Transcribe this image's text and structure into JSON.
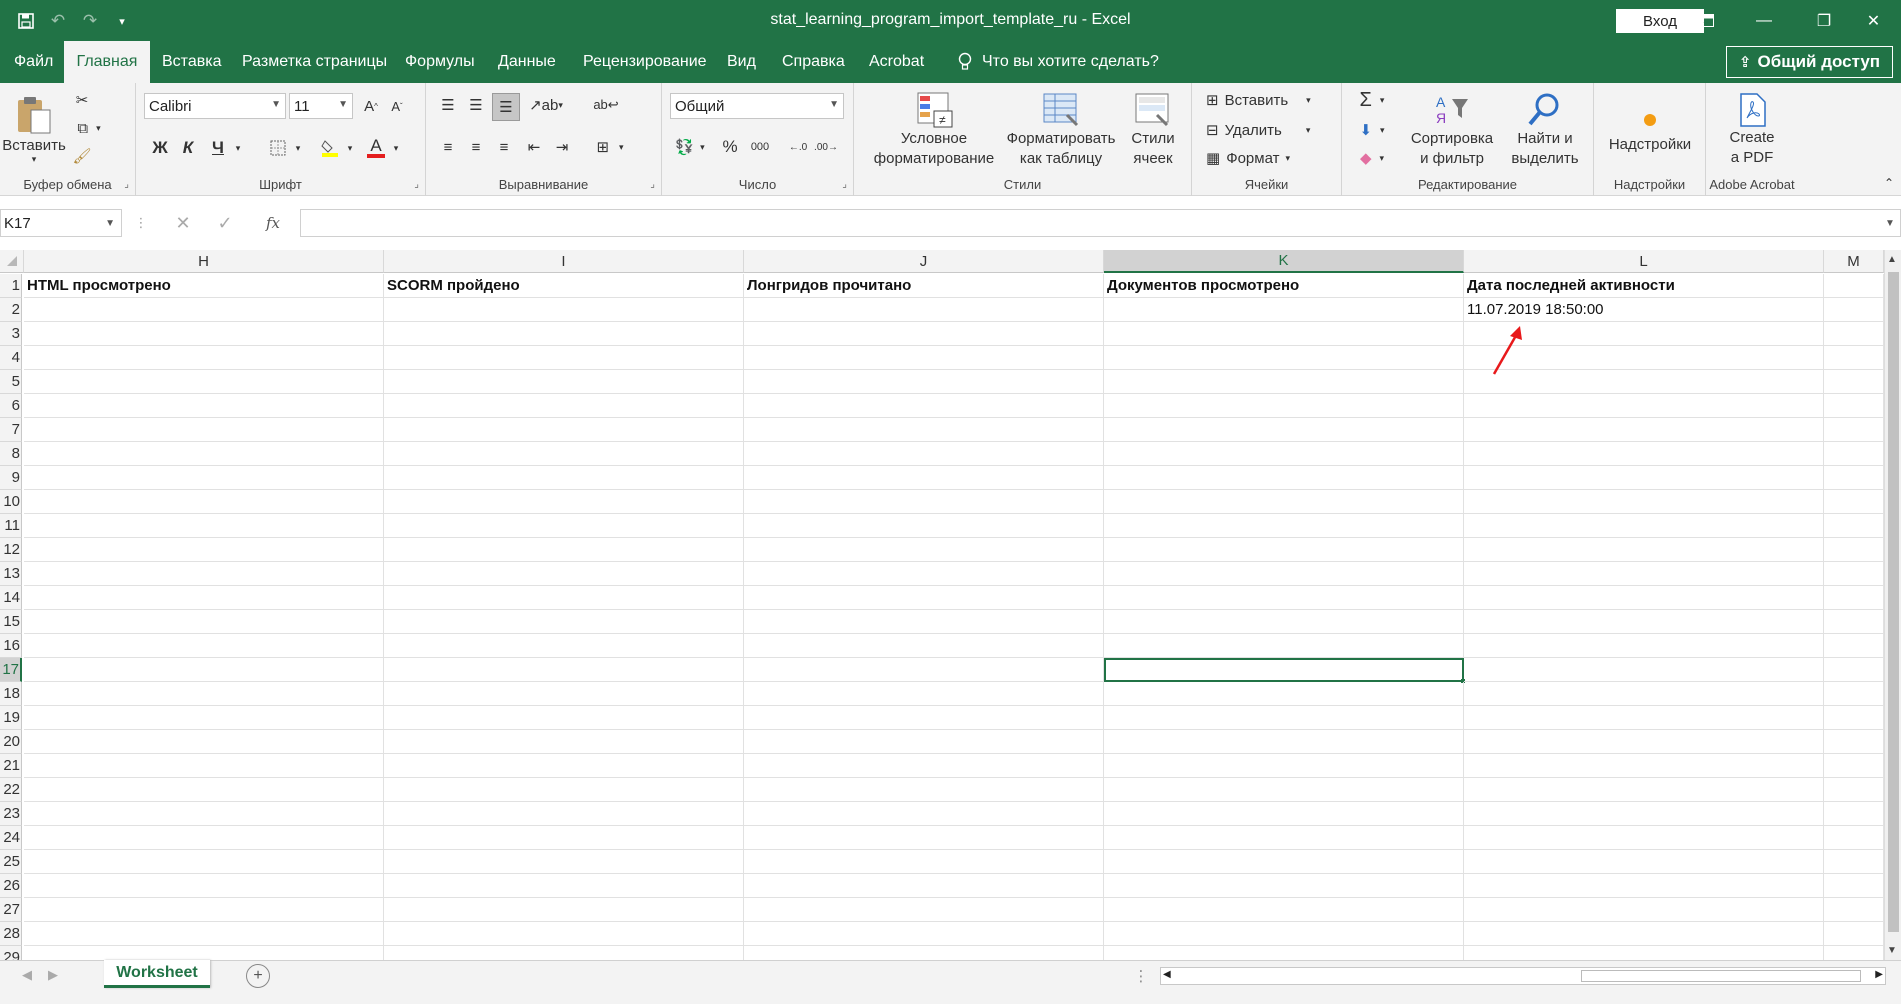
{
  "title_bar": {
    "document_title": "stat_learning_program_import_template_ru  -  Excel",
    "signin_label": "Вход",
    "qat": [
      "save-icon",
      "undo-icon",
      "redo-icon",
      "customize-icon"
    ],
    "controls": [
      "ribbon-display-icon",
      "minimize-icon",
      "restore-icon",
      "close-icon"
    ]
  },
  "tabs": [
    "Файл",
    "Главная",
    "Вставка",
    "Разметка страницы",
    "Формулы",
    "Данные",
    "Рецензирование",
    "Вид",
    "Справка",
    "Acrobat"
  ],
  "active_tab": "Главная",
  "tell_me": "Что вы хотите сделать?",
  "share_label": "Общий доступ",
  "ribbon": {
    "clipboard": {
      "paste": "Вставить",
      "group": "Буфер обмена"
    },
    "font": {
      "name": "Calibri",
      "size": "11",
      "bold": "Ж",
      "italic": "К",
      "underline": "Ч",
      "group": "Шрифт"
    },
    "alignment": {
      "group": "Выравнивание"
    },
    "number": {
      "format": "Общий",
      "percent": "%",
      "thousands": "000",
      "group": "Число"
    },
    "styles": {
      "conditional_1": "Условное",
      "conditional_2": "форматирование",
      "table_1": "Форматировать",
      "table_2": "как таблицу",
      "cell_1": "Стили",
      "cell_2": "ячеек",
      "group": "Стили"
    },
    "cells": {
      "insert": "Вставить",
      "delete": "Удалить",
      "format": "Формат",
      "group": "Ячейки"
    },
    "editing": {
      "sort_1": "Сортировка",
      "sort_2": "и фильтр",
      "find_1": "Найти и",
      "find_2": "выделить",
      "group": "Редактирование"
    },
    "addins": {
      "label": "Надстройки",
      "group": "Надстройки"
    },
    "acrobat": {
      "label_1": "Create",
      "label_2": "a PDF",
      "group": "Adobe Acrobat"
    }
  },
  "formula_bar": {
    "name_box": "K17",
    "fx": "fx",
    "value": ""
  },
  "columns": [
    "H",
    "I",
    "J",
    "K",
    "L",
    "M"
  ],
  "selected_column": "K",
  "rows": [
    "1",
    "2",
    "3",
    "4",
    "5",
    "6",
    "7",
    "8",
    "9",
    "10",
    "11",
    "12",
    "13",
    "14",
    "15",
    "16",
    "17",
    "18",
    "19",
    "20",
    "21",
    "22",
    "23",
    "24",
    "25",
    "26",
    "27",
    "28",
    "29"
  ],
  "selected_row": "17",
  "cells": {
    "H1": "HTML просмотрено",
    "I1": "SCORM пройдено",
    "J1": "Лонгридов прочитано",
    "K1": "Документов просмотрено",
    "L1": "Дата последней активности",
    "L2": "11.07.2019 18:50:00"
  },
  "annotation_color": "#e8191b",
  "accent_color": "#217346",
  "sheet_tabs": [
    "Worksheet"
  ]
}
